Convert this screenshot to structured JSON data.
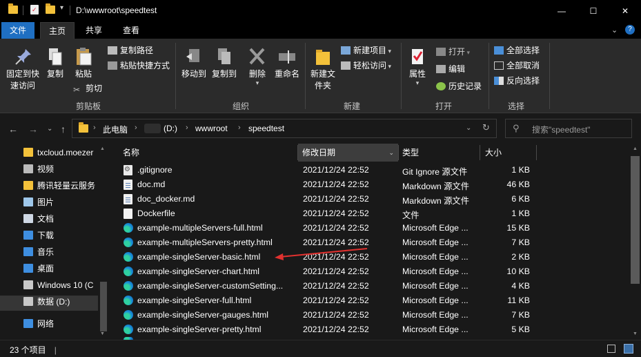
{
  "window": {
    "title": "D:\\wwwroot\\speedtest",
    "controls": [
      "—",
      "☐",
      "✕"
    ]
  },
  "ribbon_tabs": [
    "文件",
    "主页",
    "共享",
    "查看"
  ],
  "ribbon": {
    "clipboard": {
      "pin_label": "固定到快速访问",
      "copy_label": "复制",
      "paste_label": "粘贴",
      "copy_path": "复制路径",
      "paste_shortcut": "粘贴快捷方式",
      "cut": "剪切",
      "group": "剪贴板"
    },
    "organize": {
      "move_to": "移动到",
      "copy_to": "复制到",
      "delete": "删除",
      "rename": "重命名",
      "group": "组织"
    },
    "new": {
      "new_folder": "新建文件夹",
      "new_item": "新建项目",
      "easy_access": "轻松访问",
      "group": "新建"
    },
    "open": {
      "properties": "属性",
      "open": "打开",
      "edit": "编辑",
      "history": "历史记录",
      "group": "打开"
    },
    "select": {
      "select_all": "全部选择",
      "select_none": "全部取消",
      "invert": "反向选择",
      "group": "选择"
    }
  },
  "address": {
    "crumbs": [
      "此电脑",
      "(D:)",
      "wwwroot",
      "speedtest"
    ],
    "search_placeholder": "搜索\"speedtest\""
  },
  "nav_pane": [
    {
      "label": "txcloud.moezer",
      "icon": "folder-icon"
    },
    {
      "label": "视频",
      "icon": "video-icon"
    },
    {
      "label": "腾讯轻量云服务",
      "icon": "folder-icon"
    },
    {
      "label": "图片",
      "icon": "picture-icon"
    },
    {
      "label": "文档",
      "icon": "document-icon"
    },
    {
      "label": "下载",
      "icon": "download-icon"
    },
    {
      "label": "音乐",
      "icon": "music-icon"
    },
    {
      "label": "桌面",
      "icon": "desktop-icon"
    },
    {
      "label": "Windows 10 (C",
      "icon": "windows-drive-icon"
    },
    {
      "label": "数据 (D:)",
      "icon": "drive-icon"
    },
    {
      "label": "网络",
      "icon": "network-icon"
    }
  ],
  "columns": {
    "name": "名称",
    "date": "修改日期",
    "type": "类型",
    "size": "大小"
  },
  "files": [
    {
      "name": ".gitignore",
      "date": "2021/12/24 22:52",
      "type": "Git Ignore 源文件",
      "size": "1 KB",
      "icon": "settings-file-icon"
    },
    {
      "name": "doc.md",
      "date": "2021/12/24 22:52",
      "type": "Markdown 源文件",
      "size": "46 KB",
      "icon": "document-icon"
    },
    {
      "name": "doc_docker.md",
      "date": "2021/12/24 22:52",
      "type": "Markdown 源文件",
      "size": "6 KB",
      "icon": "document-icon"
    },
    {
      "name": "Dockerfile",
      "date": "2021/12/24 22:52",
      "type": "文件",
      "size": "1 KB",
      "icon": "blank-file-icon"
    },
    {
      "name": "example-multipleServers-full.html",
      "date": "2021/12/24 22:52",
      "type": "Microsoft Edge ...",
      "size": "15 KB",
      "icon": "edge-icon"
    },
    {
      "name": "example-multipleServers-pretty.html",
      "date": "2021/12/24 22:52",
      "type": "Microsoft Edge ...",
      "size": "7 KB",
      "icon": "edge-icon"
    },
    {
      "name": "example-singleServer-basic.html",
      "date": "2021/12/24 22:52",
      "type": "Microsoft Edge ...",
      "size": "2 KB",
      "icon": "edge-icon"
    },
    {
      "name": "example-singleServer-chart.html",
      "date": "2021/12/24 22:52",
      "type": "Microsoft Edge ...",
      "size": "10 KB",
      "icon": "edge-icon"
    },
    {
      "name": "example-singleServer-customSetting...",
      "date": "2021/12/24 22:52",
      "type": "Microsoft Edge ...",
      "size": "4 KB",
      "icon": "edge-icon"
    },
    {
      "name": "example-singleServer-full.html",
      "date": "2021/12/24 22:52",
      "type": "Microsoft Edge ...",
      "size": "11 KB",
      "icon": "edge-icon"
    },
    {
      "name": "example-singleServer-gauges.html",
      "date": "2021/12/24 22:52",
      "type": "Microsoft Edge ...",
      "size": "7 KB",
      "icon": "edge-icon"
    },
    {
      "name": "example-singleServer-pretty.html",
      "date": "2021/12/24 22:52",
      "type": "Microsoft Edge ...",
      "size": "5 KB",
      "icon": "edge-icon"
    }
  ],
  "status": {
    "count": "23 个项目"
  },
  "colors": {
    "accent": "#1f6fc2",
    "annotation_arrow": "#e0312f",
    "folder": "#f3c13a"
  }
}
